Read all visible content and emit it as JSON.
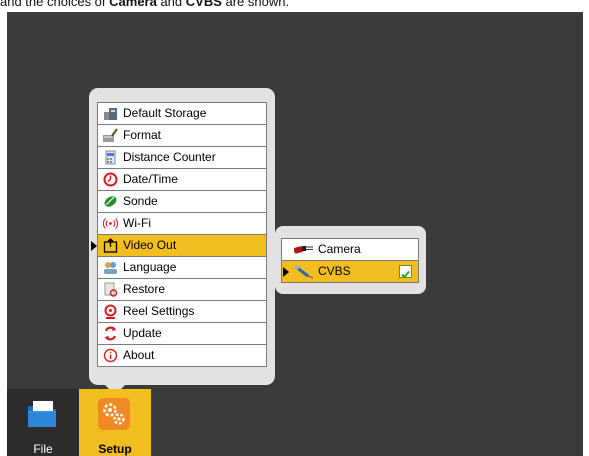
{
  "caption": {
    "pre": "and the choices of ",
    "b1": "Camera",
    "mid": " and ",
    "b2": "CVBS",
    "post": " are shown."
  },
  "setup_menu": {
    "items": [
      {
        "label": "Default Storage",
        "icon": "storage-icon"
      },
      {
        "label": "Format",
        "icon": "format-icon"
      },
      {
        "label": "Distance Counter",
        "icon": "distance-counter-icon"
      },
      {
        "label": "Date/Time",
        "icon": "clock-icon"
      },
      {
        "label": "Sonde",
        "icon": "sonde-icon"
      },
      {
        "label": "Wi-Fi",
        "icon": "wifi-icon"
      },
      {
        "label": "Video Out",
        "icon": "video-out-icon",
        "selected": true
      },
      {
        "label": "Language",
        "icon": "language-icon"
      },
      {
        "label": "Restore",
        "icon": "restore-icon"
      },
      {
        "label": "Reel Settings",
        "icon": "reel-icon"
      },
      {
        "label": "Update",
        "icon": "update-icon"
      },
      {
        "label": "About",
        "icon": "about-icon"
      }
    ]
  },
  "video_out_submenu": {
    "items": [
      {
        "label": "Camera",
        "icon": "camera-connector-icon",
        "selected": false
      },
      {
        "label": "CVBS",
        "icon": "cvbs-connector-icon",
        "selected": true,
        "checked": true
      }
    ]
  },
  "taskbar": {
    "file_label": "File",
    "setup_label": "Setup"
  },
  "colors": {
    "background": "#3b3b3b",
    "highlight": "#f1bd1f",
    "panel": "#e2e2e2",
    "setup_tile": "#f08a24"
  }
}
